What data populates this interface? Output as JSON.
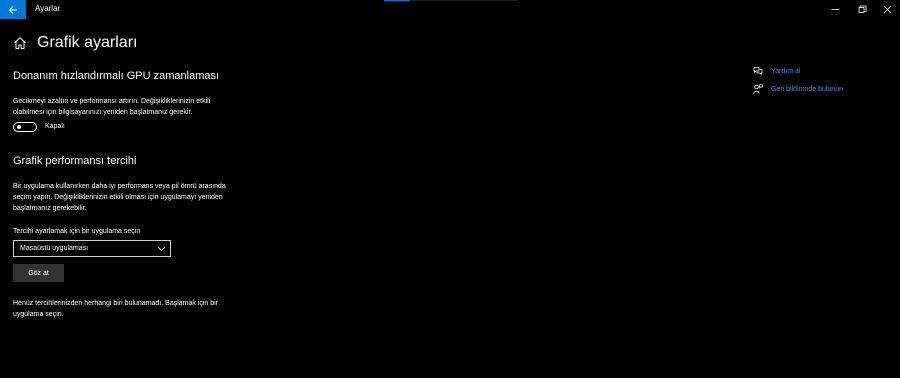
{
  "window": {
    "title": "Ayarlar"
  },
  "page": {
    "title": "Grafik ayarları"
  },
  "gpu_scheduling": {
    "heading": "Donanım hızlandırmalı GPU zamanlaması",
    "description_line1": "Gecikmeyi azaltın ve performansı artırın. Değişikliklerinizin etkili",
    "description_line2": "olabilmesi için bilgisayarınızı yeniden başlatmanız gerekir.",
    "toggle_state": "off",
    "toggle_label": "Kapalı"
  },
  "graphics_preference": {
    "heading": "Grafik performansı tercihi",
    "description_line1": "Bir uygulama kullanırken daha iyi performans veya pil ömrü arasında",
    "description_line2": "seçim yapın. Değişikliklerinizin etkili olması için uygulamayı yeniden",
    "description_line3": "başlatmanız gerekebilir.",
    "select_label": "Tercihi ayarlamak için bir uygulama seçin",
    "select_value": "Masaüstü uygulaması",
    "browse_button": "Göz at",
    "empty_line1": "Henüz tercihlerinizden herhangi biri bulunamadı. Başlamak için bir",
    "empty_line2": "uygulama seçin."
  },
  "sidebar": {
    "help_label": "Yardım al",
    "help_icon": "chat-help-icon",
    "feedback_label": "Geri bildirimde bulunun",
    "feedback_icon": "feedback-person-icon"
  },
  "colors": {
    "accent": "#0078d7",
    "link": "#3d8fe0",
    "background": "#000000",
    "button": "#333333"
  }
}
